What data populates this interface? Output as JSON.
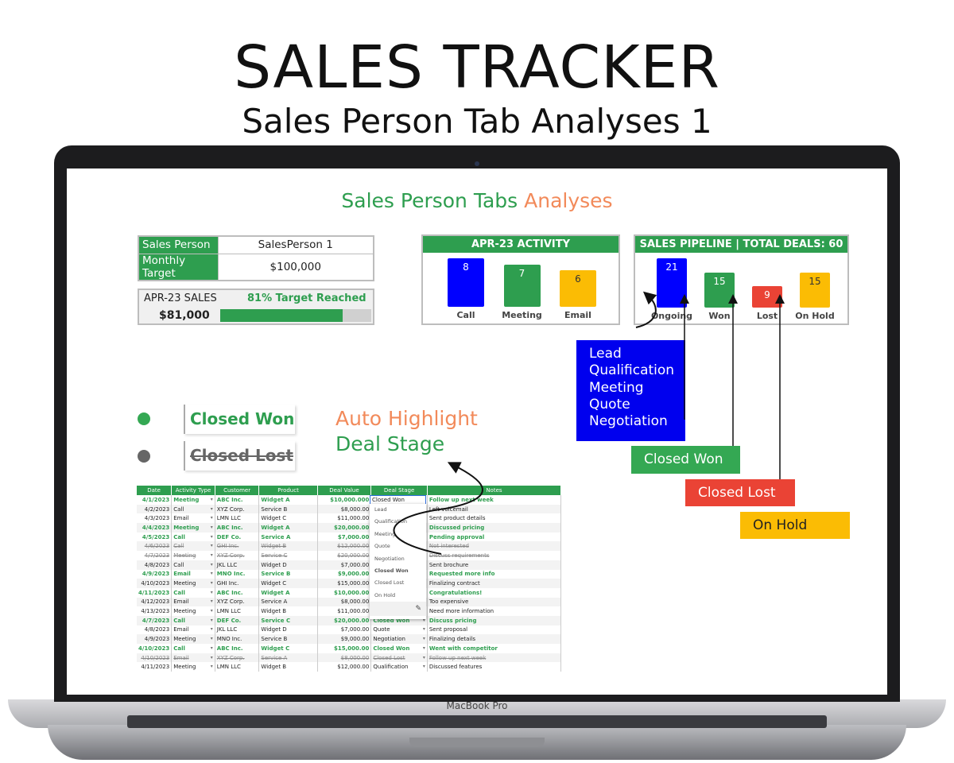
{
  "header": {
    "title": "SALES TRACKER",
    "subtitle": "Sales Person Tab Analyses 1"
  },
  "device": {
    "brand": "MacBook Pro"
  },
  "sheet": {
    "title_part1": "Sales Person Tabs",
    "title_part2": "Analyses",
    "sales_person": {
      "label": "Sales Person",
      "value": "SalesPerson 1"
    },
    "monthly_target": {
      "label": "Monthly Target",
      "value": "$100,000"
    },
    "sales_card": {
      "label": "APR-23 SALES",
      "value": "$81,000",
      "status": "81% Target Reached",
      "progress_percent": 81
    }
  },
  "chart_data": [
    {
      "type": "bar",
      "title": "APR-23 ACTIVITY",
      "categories": [
        "Call",
        "Meeting",
        "Email"
      ],
      "values": [
        8,
        7,
        6
      ],
      "colors": [
        "#0000ff",
        "#2e9e4f",
        "#fbbc04"
      ]
    },
    {
      "type": "bar",
      "title": "SALES PIPELINE  |  TOTAL DEALS:  60",
      "categories": [
        "Ongoing",
        "Won",
        "Lost",
        "On Hold"
      ],
      "values": [
        21,
        15,
        9,
        15
      ],
      "colors": [
        "#0000ff",
        "#2e9e4f",
        "#ea4335",
        "#fbbc04"
      ]
    }
  ],
  "legend": {
    "won": "Closed Won",
    "lost": "Closed Lost",
    "colors": {
      "won": "#34a853",
      "lost": "#666666"
    }
  },
  "annotation": {
    "line1": "Auto Highlight",
    "line2": "Deal Stage"
  },
  "pipeline_notes": {
    "ongoing_stages": [
      "Lead",
      "Qualification",
      "Meeting",
      "Quote",
      "Negotiation"
    ],
    "won": "Closed Won",
    "lost": "Closed Lost",
    "hold": "On Hold"
  },
  "grid": {
    "columns": [
      "Date",
      "Activity Type",
      "Customer",
      "Product",
      "Deal Value",
      "Deal Stage",
      "Notes"
    ],
    "rows": [
      {
        "s": "won",
        "c": [
          "4/1/2023",
          "Meeting",
          "ABC Inc.",
          "Widget A",
          "$10,000.000",
          "Closed Won",
          "Follow up next week"
        ]
      },
      {
        "s": "",
        "c": [
          "4/2/2023",
          "Call",
          "XYZ Corp.",
          "Service B",
          "$8,000.00",
          "",
          "Left voicemail"
        ]
      },
      {
        "s": "",
        "c": [
          "4/3/2023",
          "Email",
          "LMN LLC",
          "Widget C",
          "$11,000.00",
          "",
          "Sent product details"
        ]
      },
      {
        "s": "won",
        "c": [
          "4/4/2023",
          "Meeting",
          "ABC Inc.",
          "Widget A",
          "$20,000.00",
          "",
          "Discussed pricing"
        ]
      },
      {
        "s": "won",
        "c": [
          "4/5/2023",
          "Call",
          "DEF Co.",
          "Service A",
          "$7,000.00",
          "",
          "Pending approval"
        ]
      },
      {
        "s": "lost",
        "c": [
          "4/6/2023",
          "Call",
          "GHI Inc.",
          "Widget B",
          "$12,000.00",
          "",
          "Not interested"
        ]
      },
      {
        "s": "lost",
        "c": [
          "4/7/2023",
          "Meeting",
          "XYZ Corp.",
          "Service C",
          "$20,000.00",
          "",
          "Discuss requirements"
        ]
      },
      {
        "s": "",
        "c": [
          "4/8/2023",
          "Call",
          "JKL LLC",
          "Widget D",
          "$7,000.00",
          "",
          "Sent brochure"
        ]
      },
      {
        "s": "won",
        "c": [
          "4/9/2023",
          "Email",
          "MNO Inc.",
          "Service B",
          "$9,000.00",
          "",
          "Requested more info"
        ]
      },
      {
        "s": "",
        "c": [
          "4/10/2023",
          "Meeting",
          "GHI Inc.",
          "Widget C",
          "$15,000.00",
          "",
          "Finalizing contract"
        ]
      },
      {
        "s": "won",
        "c": [
          "4/11/2023",
          "Call",
          "ABC Inc.",
          "Widget A",
          "$10,000.00",
          "",
          "Congratulations!"
        ]
      },
      {
        "s": "",
        "c": [
          "4/12/2023",
          "Email",
          "XYZ Corp.",
          "Service A",
          "$8,000.00",
          "",
          "Too expensive"
        ]
      },
      {
        "s": "",
        "c": [
          "4/13/2023",
          "Meeting",
          "LMN LLC",
          "Widget B",
          "$11,000.00",
          "",
          "Need more information"
        ]
      },
      {
        "s": "won",
        "c": [
          "4/7/2023",
          "Call",
          "DEF Co.",
          "Service C",
          "$20,000.00",
          "Closed Won",
          "Discuss pricing"
        ]
      },
      {
        "s": "",
        "c": [
          "4/8/2023",
          "Email",
          "JKL LLC",
          "Widget D",
          "$7,000.00",
          "Quote",
          "Sent proposal"
        ]
      },
      {
        "s": "",
        "c": [
          "4/9/2023",
          "Meeting",
          "MNO Inc.",
          "Service B",
          "$9,000.00",
          "Negotiation",
          "Finalizing details"
        ]
      },
      {
        "s": "won",
        "c": [
          "4/10/2023",
          "Call",
          "ABC Inc.",
          "Widget C",
          "$15,000.00",
          "Closed Won",
          "Went with competitor"
        ]
      },
      {
        "s": "lost",
        "c": [
          "4/10/2023",
          "Email",
          "XYZ Corp.",
          "Service A",
          "$8,000.00",
          "Closed Lost",
          "Follow up next week"
        ]
      },
      {
        "s": "",
        "c": [
          "4/11/2023",
          "Meeting",
          "LMN LLC",
          "Widget B",
          "$12,000.00",
          "Qualification",
          "Discussed features"
        ]
      }
    ],
    "selected_cell": "Closed Won",
    "dropdown_options": [
      "Lead",
      "Qualification",
      "Meeting",
      "Quote",
      "Negotiation",
      "Closed Won",
      "Closed Lost",
      "On Hold"
    ]
  }
}
